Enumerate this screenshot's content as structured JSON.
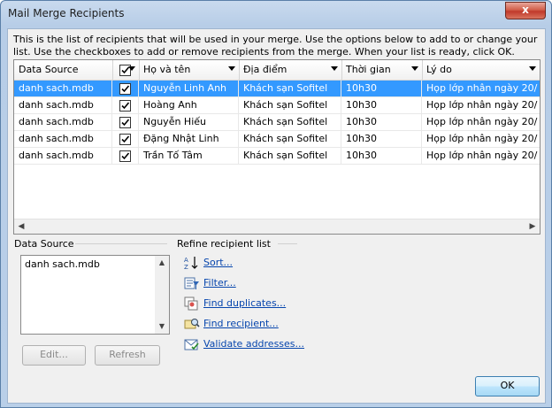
{
  "window": {
    "title": "Mail Merge Recipients",
    "close_glyph": "x"
  },
  "intro_text": "This is the list of recipients that will be used in your merge.  Use the options below to add to or change your list.  Use the checkboxes to add or remove recipients from the merge.  When your list is ready, click OK.",
  "table": {
    "columns": [
      "Data Source",
      "",
      "Họ và tên",
      "Địa điểm",
      "Thời gian",
      "Lý do"
    ],
    "rows": [
      {
        "source": "danh sach.mdb",
        "checked": true,
        "name": "Nguyễn Linh Anh",
        "place": "Khách sạn Sofitel",
        "time": "10h30",
        "reason": "Họp lớp nhân ngày 20/..."
      },
      {
        "source": "danh sach.mdb",
        "checked": true,
        "name": "Hoàng Anh",
        "place": "Khách sạn Sofitel",
        "time": "10h30",
        "reason": "Họp lớp nhân ngày 20/..."
      },
      {
        "source": "danh sach.mdb",
        "checked": true,
        "name": "Nguyễn Hiếu",
        "place": "Khách sạn Sofitel",
        "time": "10h30",
        "reason": "Họp lớp nhân ngày 20/..."
      },
      {
        "source": "danh sach.mdb",
        "checked": true,
        "name": "Đặng Nhật Linh",
        "place": "Khách sạn Sofitel",
        "time": "10h30",
        "reason": "Họp lớp nhân ngày 20/..."
      },
      {
        "source": "danh sach.mdb",
        "checked": true,
        "name": "Trần Tố Tâm",
        "place": "Khách sạn Sofitel",
        "time": "10h30",
        "reason": "Họp lớp nhân ngày 20/..."
      }
    ],
    "selected_row": 0
  },
  "data_source": {
    "label": "Data Source",
    "items": [
      "danh sach.mdb"
    ],
    "edit_label": "Edit...",
    "refresh_label": "Refresh"
  },
  "refine": {
    "label": "Refine recipient list",
    "items": [
      {
        "label": "Sort...",
        "icon": "sort-az-icon"
      },
      {
        "label": "Filter...",
        "icon": "filter-icon"
      },
      {
        "label": "Find duplicates...",
        "icon": "find-duplicates-icon"
      },
      {
        "label": "Find recipient...",
        "icon": "find-recipient-icon"
      },
      {
        "label": "Validate addresses...",
        "icon": "validate-addresses-icon"
      }
    ]
  },
  "ok_label": "OK",
  "colors": {
    "selection": "#3399ff",
    "link": "#0645ad",
    "close": "#c0392b"
  }
}
